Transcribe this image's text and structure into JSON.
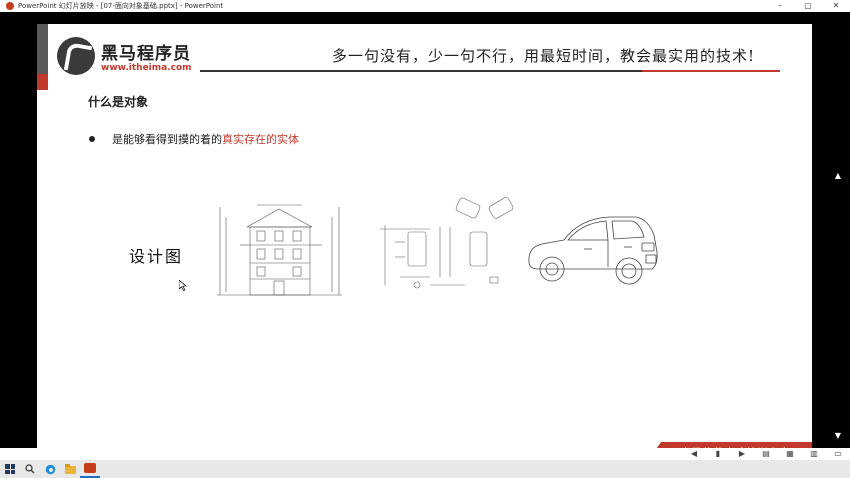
{
  "window": {
    "title": "PowerPoint 幻灯片放映 - [07-面向对象基础.pptx] - PowerPoint",
    "controls": [
      "–",
      "▢",
      "✕"
    ]
  },
  "slide": {
    "logo": {
      "brand": "黑马程序员",
      "site": "www.itheima.com"
    },
    "slogan": "多一句没有，少一句不行，用最短时间，教会最实用的技术!",
    "heading": "什么是对象",
    "bullet": {
      "prefix": "是能够看得到摸的着的",
      "highlight": "真实存在的实体"
    },
    "design_label": "设计图",
    "footer_tagline": "高级软件人才培训专家",
    "colors": {
      "accent": "#c0392b",
      "dark": "#333333"
    }
  },
  "status_bar": {
    "icons": [
      "prev-icon",
      "pause-icon",
      "next-icon",
      "normal-view-icon",
      "slide-sorter-icon",
      "reading-view-icon",
      "slideshow-icon"
    ]
  },
  "taskbar": {
    "icons": [
      "windows-start-icon",
      "search-icon",
      "edge-icon",
      "file-explorer-icon",
      "powerpoint-icon"
    ]
  },
  "side_controls": [
    "▲",
    "▼",
    "⤢"
  ]
}
